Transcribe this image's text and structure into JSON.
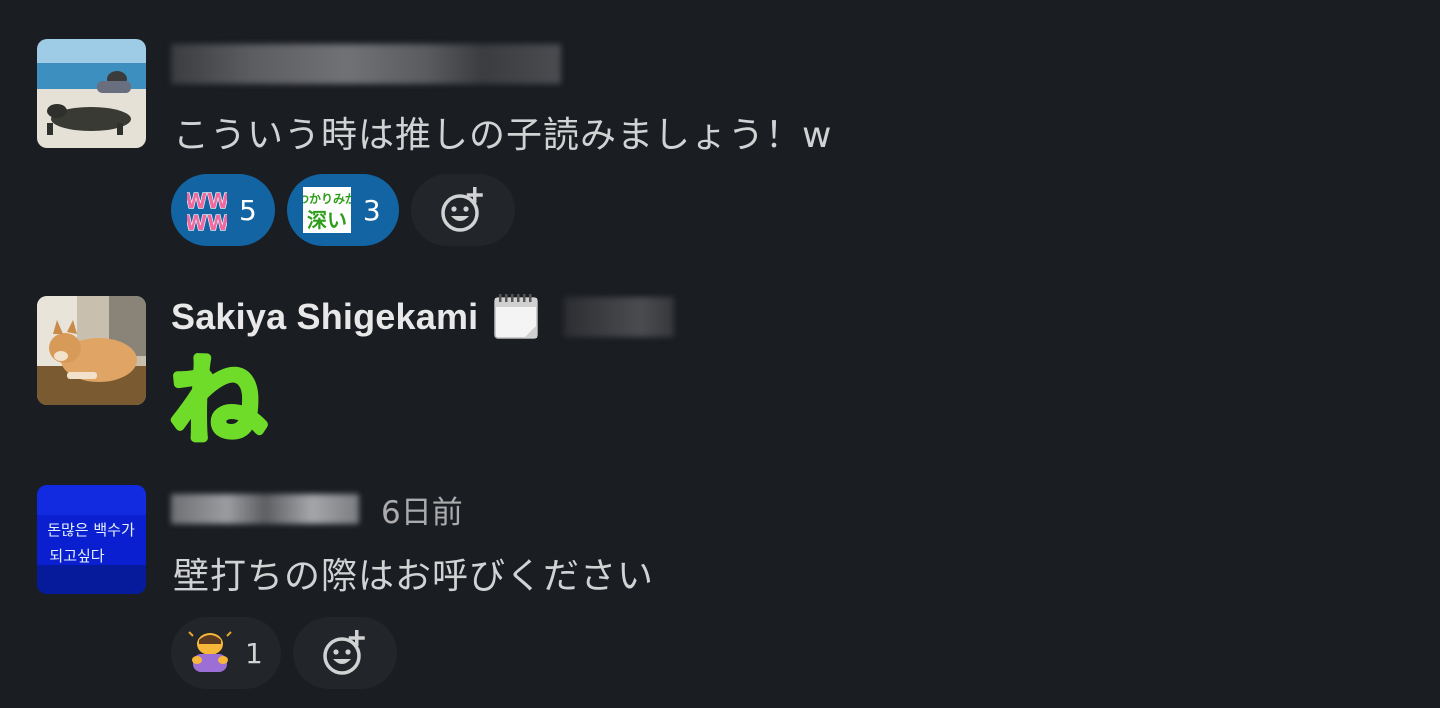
{
  "messages": [
    {
      "author": "",
      "text": "こういう時は推しの子読みましょう！w",
      "reactions": [
        {
          "emoji": "www-emoji",
          "label": "WW WW",
          "count": "5",
          "active": true
        },
        {
          "emoji": "wakarimi-ga-fukai-emoji",
          "label": "わかりみが 深い",
          "count": "3",
          "active": true
        }
      ]
    },
    {
      "author": "Sakiya Shigekami",
      "status_icon": "calendar-icon",
      "text": "ね"
    },
    {
      "author": "",
      "timestamp": "6日前",
      "text": "壁打ちの際はお呼びください",
      "reactions": [
        {
          "emoji": "person-bowing-emoji",
          "count": "1",
          "active": false
        }
      ],
      "avatar_text": [
        "돈많은 백수가",
        "되고싶다"
      ]
    }
  ],
  "colors": {
    "background": "#1a1d21",
    "reaction_active": "#1264a3",
    "reaction_idle": "#222529",
    "ne_green": "#6fdc2a"
  }
}
